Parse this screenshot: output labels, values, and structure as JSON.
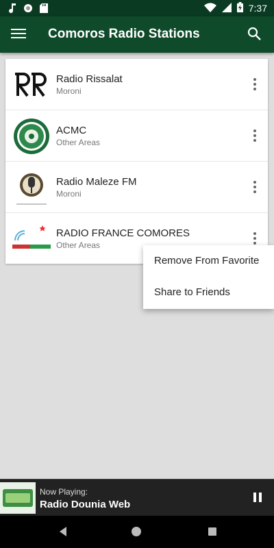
{
  "status_bar": {
    "time": "7:37",
    "icons": [
      "music-note-icon",
      "circle-icon",
      "sd-card-icon",
      "wifi-icon",
      "signal-icon",
      "battery-charging-icon"
    ]
  },
  "app_bar": {
    "title": "Comoros Radio Stations",
    "menu_icon": "hamburger-menu-icon",
    "search_icon": "search-icon"
  },
  "stations": [
    {
      "name": "Radio Rissalat",
      "area": "Moroni",
      "logo": "rr-logo"
    },
    {
      "name": "ACMC",
      "area": "Other Areas",
      "logo": "acmc-seal-logo"
    },
    {
      "name": "Radio Maleze FM",
      "area": "Moroni",
      "logo": "microphone-logo"
    },
    {
      "name": "RADIO FRANCE COMORES",
      "area": "Other Areas",
      "logo": "rfc-logo"
    }
  ],
  "popup_menu": {
    "items": [
      "Remove From Favorite",
      "Share to Friends"
    ]
  },
  "now_playing": {
    "label": "Now Playing:",
    "title": "Radio Dounia Web",
    "control_icon": "pause-icon"
  },
  "nav_bar": {
    "icons": [
      "back-icon",
      "home-icon",
      "recent-apps-icon"
    ]
  },
  "colors": {
    "appbar": "#0f4a2a",
    "statusbar": "#0a3a22",
    "background": "#dedede"
  }
}
